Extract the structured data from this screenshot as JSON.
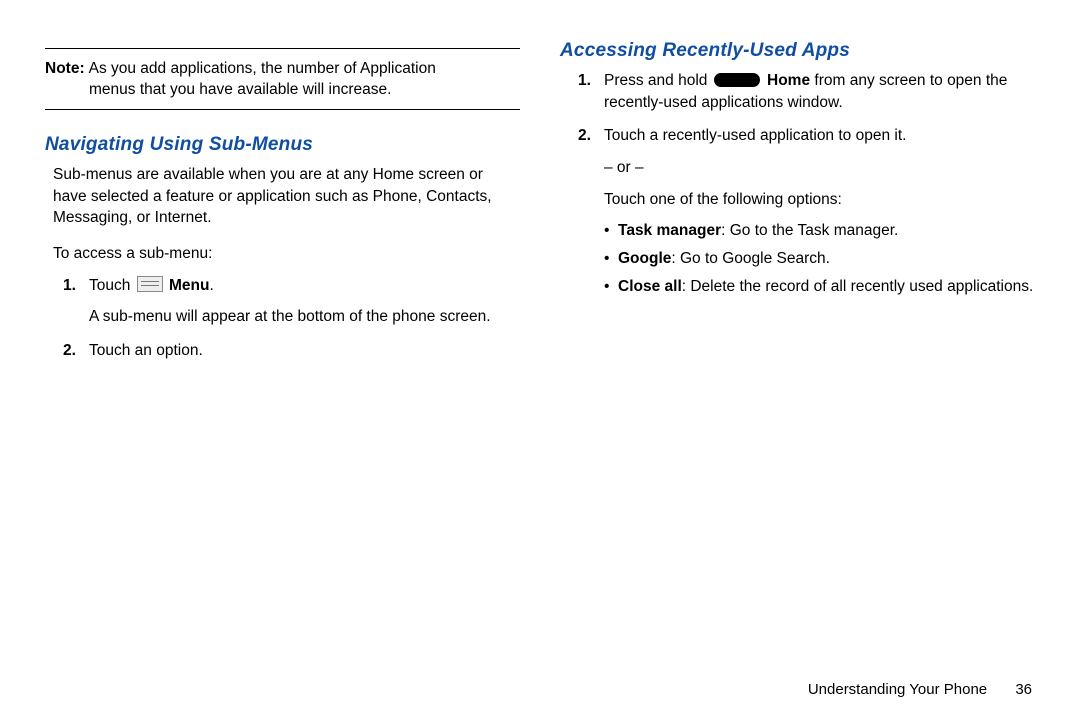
{
  "left": {
    "note_label": "Note:",
    "note_line1": "As you add applications, the number of Application",
    "note_line2": "menus that you have available will increase.",
    "heading": "Navigating Using Sub-Menus",
    "intro": "Sub-menus are available when you are at any Home screen or have selected a feature or application such as Phone, Contacts, Messaging, or Internet.",
    "access_line": "To access a sub-menu:",
    "step1_num": "1.",
    "step1_touch": "Touch ",
    "step1_menu_word": " Menu",
    "step1_period": ".",
    "step1_desc": "A sub-menu will appear at the bottom of the phone screen.",
    "step2_num": "2.",
    "step2_text": "Touch an option."
  },
  "right": {
    "heading": "Accessing Recently-Used Apps",
    "step1_num": "1.",
    "step1_prefix": "Press and hold ",
    "step1_home_word": " Home",
    "step1_suffix": " from any screen to open the recently-used applications window.",
    "step2_num": "2.",
    "step2_line1": "Touch a recently-used application to open it.",
    "step2_or": "– or –",
    "step2_line3": "Touch one of the following options:",
    "bullets": [
      {
        "label": "Task manager",
        "rest": ": Go to the Task manager."
      },
      {
        "label": "Google",
        "rest": ": Go to Google Search."
      },
      {
        "label": "Close all",
        "rest": ": Delete the record of all recently used applications."
      }
    ]
  },
  "footer": {
    "section": "Understanding Your Phone",
    "page": "36"
  }
}
